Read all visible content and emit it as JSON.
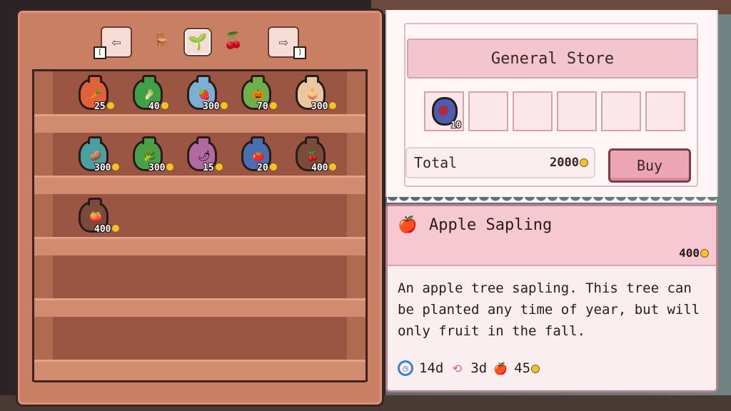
{
  "categories": [
    {
      "name": "prev-category",
      "icon": "arrow-left-icon",
      "key": "["
    },
    {
      "name": "furniture",
      "icon": "chair-icon"
    },
    {
      "name": "seeds",
      "icon": "seed-bag-icon",
      "active": true
    },
    {
      "name": "saplings",
      "icon": "cherry-sapling-icon"
    },
    {
      "name": "next-category",
      "icon": "arrow-right-icon",
      "key": "]"
    }
  ],
  "shelves": [
    {
      "items": [
        {
          "color": "#e0613a",
          "icon": "🥕",
          "price": "25"
        },
        {
          "color": "#3fa04a",
          "icon": "🥬",
          "price": "40"
        },
        {
          "color": "#7ab0d6",
          "icon": "🍓",
          "price": "300"
        },
        {
          "color": "#6fb04a",
          "icon": "🎃",
          "price": "70"
        },
        {
          "color": "#e8c8a0",
          "icon": "🧅",
          "price": "300"
        }
      ]
    },
    {
      "items": [
        {
          "color": "#4aa0a0",
          "icon": "🥔",
          "price": "300"
        },
        {
          "color": "#4aa04a",
          "icon": "🥦",
          "price": "300"
        },
        {
          "color": "#b06aa0",
          "icon": "🌶",
          "price": "15"
        },
        {
          "color": "#4a6fb0",
          "icon": "🍅",
          "price": "20"
        },
        {
          "color": "#7a4a3a",
          "icon": "🍒",
          "price": "400",
          "sapling": true
        }
      ]
    },
    {
      "items": [
        {
          "color": "#7a4a3a",
          "icon": "🍑",
          "price": "400",
          "sapling": true
        }
      ]
    },
    {
      "items": []
    },
    {
      "items": []
    }
  ],
  "store": {
    "title": "General Store",
    "cart": [
      {
        "qty": "10"
      },
      {},
      {},
      {},
      {},
      {}
    ],
    "total_label": "Total",
    "total_value": "2000",
    "buy_label": "Buy"
  },
  "detail": {
    "icon": "apple-sapling-icon",
    "name": "Apple Sapling",
    "price": "400",
    "description": "An apple tree sapling. This tree can be planted any time of year, but will only fruit in the fall.",
    "grow_time": "14d",
    "regrow_time": "3d",
    "sell_price": "45"
  },
  "colors": {
    "coin": "#f2c12e",
    "panel_pink": "#f6c9d2",
    "cabinet": "#c97f63"
  }
}
